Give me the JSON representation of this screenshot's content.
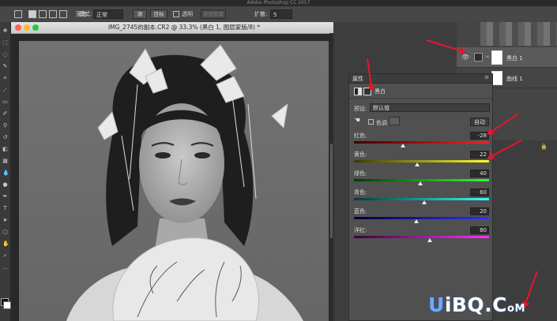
{
  "app": {
    "title": "Adobe Photoshop CC 2017"
  },
  "options_bar": {
    "width_label": "宽度:",
    "mode_label": "模式:",
    "mode_value": "正常",
    "path_label": "源",
    "dest_label": "目标",
    "transparent_label": "透明",
    "use_pattern_label": "使用图案",
    "diffusion_label": "扩散:",
    "diffusion_value": "5"
  },
  "document": {
    "title": "IMG_2745的副本.CR2 @ 33.3% (黑白 1, 图层蒙版/8) *"
  },
  "layers": {
    "rows": [
      {
        "name": "黑白 1"
      },
      {
        "name": "曲线 1"
      }
    ],
    "lock_icon": "lock-icon"
  },
  "properties": {
    "panel_tab": "属性",
    "header_label": "黑白",
    "preset_label": "预设:",
    "preset_value": "默认值",
    "tint_label": "色调",
    "auto_label": "自动",
    "sliders": [
      {
        "label": "红色:",
        "value": "-28",
        "fraction": 0.36,
        "gradient": [
          "#3a0000",
          "#ff2020"
        ]
      },
      {
        "label": "黄色:",
        "value": "22",
        "fraction": 0.47,
        "gradient": [
          "#3a3a00",
          "#ffff30"
        ]
      },
      {
        "label": "绿色:",
        "value": "40",
        "fraction": 0.49,
        "gradient": [
          "#003a00",
          "#30ff30"
        ]
      },
      {
        "label": "青色:",
        "value": "60",
        "fraction": 0.52,
        "gradient": [
          "#003a3a",
          "#30ffff"
        ]
      },
      {
        "label": "蓝色:",
        "value": "20",
        "fraction": 0.46,
        "gradient": [
          "#00003a",
          "#3030ff"
        ]
      },
      {
        "label": "洋红:",
        "value": "80",
        "fraction": 0.56,
        "gradient": [
          "#3a003a",
          "#ff30ff"
        ]
      }
    ]
  },
  "watermark": {
    "prefix": "U",
    "main": "iBQ.C",
    "tail": "oM"
  },
  "colors": {
    "annotation_arrow": "#e4162a",
    "panel": "#505050",
    "canvas": "#6e6e6e"
  }
}
